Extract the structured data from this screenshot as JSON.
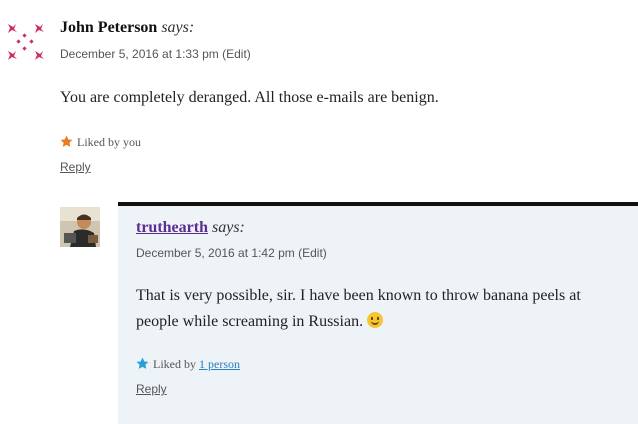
{
  "comment1": {
    "author": "John Peterson",
    "says": "says:",
    "date": "December 5, 2016 at 1:33 pm",
    "edit": "(Edit)",
    "text": "You are completely deranged. All those e-mails are benign.",
    "liked": "Liked by you",
    "reply": "Reply",
    "star_color": "#e67e22"
  },
  "comment2": {
    "author": "truthearth",
    "says": "says:",
    "date": "December 5, 2016 at 1:42 pm",
    "edit": "(Edit)",
    "text_line1": "That is very possible, sir. I have been known to throw banana peels at",
    "text_line2": "people while screaming in Russian.",
    "liked_prefix": "Liked by",
    "liked_link": "1 person",
    "reply": "Reply",
    "star_color": "#2a9fd6",
    "author_color": "#5c2d91"
  }
}
